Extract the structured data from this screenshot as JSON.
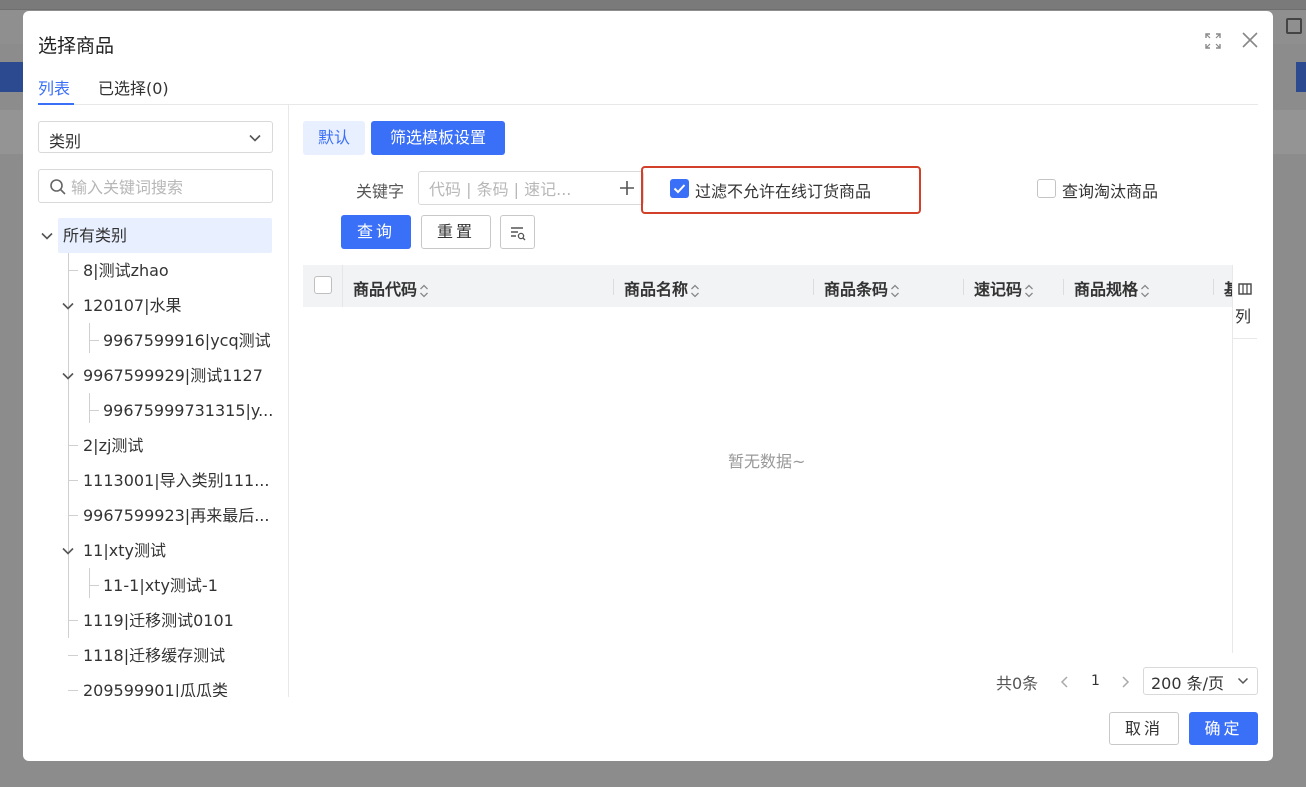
{
  "modal": {
    "title": "选择商品"
  },
  "tabs": [
    {
      "label": "列表",
      "active": true
    },
    {
      "label": "已选择(0)",
      "active": false
    }
  ],
  "left": {
    "category_select": "类别",
    "search_placeholder": "输入关键词搜索",
    "tree": [
      {
        "label": "所有类别",
        "level": 0,
        "expanded": true,
        "selected": true
      },
      {
        "label": "8|测试zhao",
        "level": 1
      },
      {
        "label": "120107|水果",
        "level": 1,
        "expanded": true
      },
      {
        "label": "9967599916|ycq测试",
        "level": 2
      },
      {
        "label": "9967599929|测试1127",
        "level": 1,
        "expanded": true
      },
      {
        "label": "99675999731315|y...",
        "level": 2
      },
      {
        "label": "2|zj测试",
        "level": 1
      },
      {
        "label": "1113001|导入类别111...",
        "level": 1
      },
      {
        "label": "9967599923|再来最后...",
        "level": 1
      },
      {
        "label": "11|xty测试",
        "level": 1,
        "expanded": true
      },
      {
        "label": "11-1|xty测试-1",
        "level": 2
      },
      {
        "label": "1119|迁移测试0101",
        "level": 1
      },
      {
        "label": "1118|迁移缓存测试",
        "level": 1
      },
      {
        "label": "209599901|瓜瓜类",
        "level": 1
      }
    ]
  },
  "filters": {
    "default_label": "默认",
    "template_label": "筛选模板设置",
    "keyword_label": "关键字",
    "keyword_placeholder": "代码 | 条码 | 速记...",
    "filter_online_label": "过滤不允许在线订货商品",
    "filter_online_checked": true,
    "query_eliminated_label": "查询淘汰商品",
    "query_eliminated_checked": false,
    "query_button": "查询",
    "reset_button": "重置"
  },
  "table": {
    "columns": [
      "商品代码",
      "商品名称",
      "商品条码",
      "速记码",
      "商品规格",
      "基"
    ],
    "column_setting_label": "列",
    "empty_text": "暂无数据~"
  },
  "pager": {
    "total": "共0条",
    "page": "1",
    "page_size": "200 条/页"
  },
  "footer": {
    "cancel": "取消",
    "ok": "确定"
  },
  "colors": {
    "primary": "#3a6ff7",
    "highlight": "#d2402a"
  }
}
